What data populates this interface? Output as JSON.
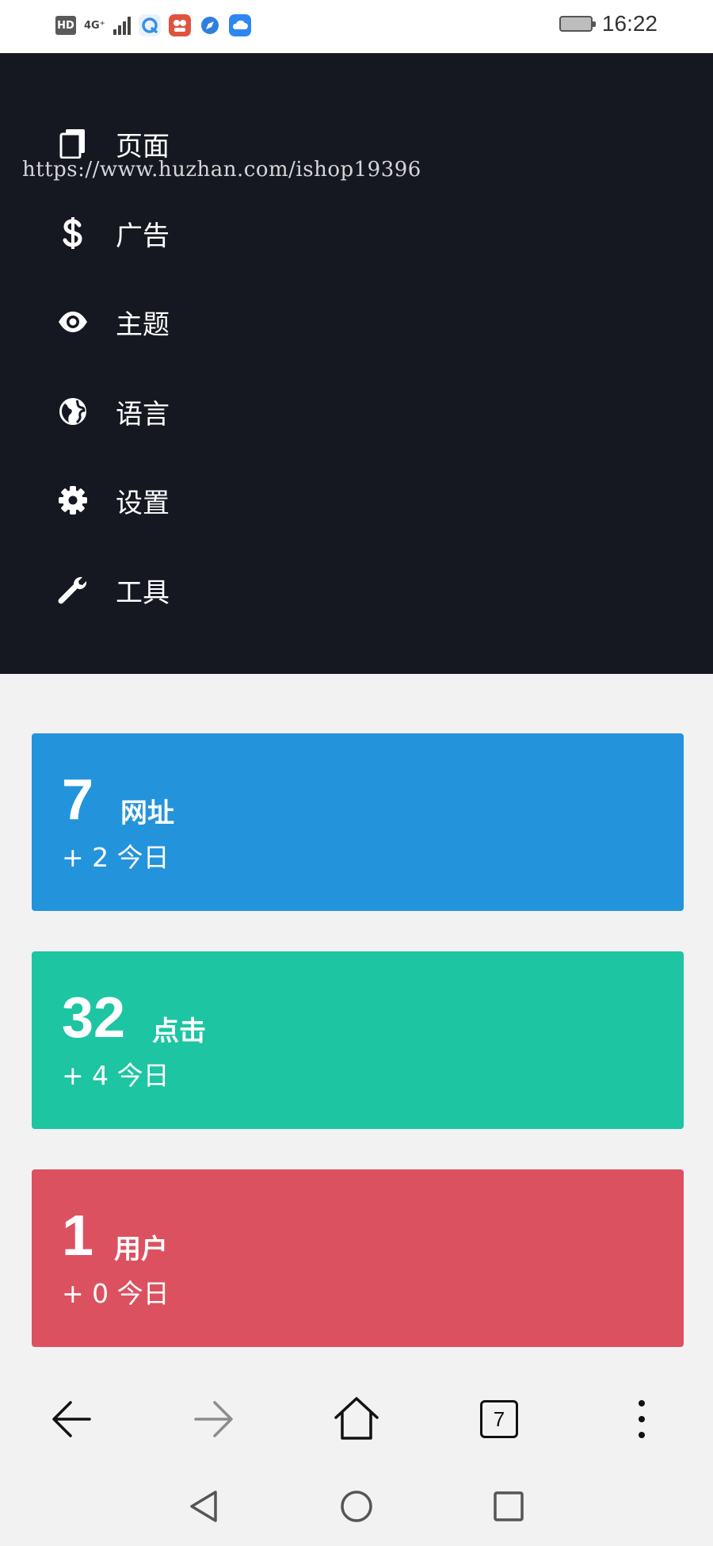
{
  "status_bar": {
    "hd": "HD",
    "network": "4G⁺",
    "time": "16:22",
    "app_icons": [
      {
        "name": "qq-browser-icon",
        "color": "#3a8ee6"
      },
      {
        "name": "photo-app-icon",
        "color": "#e0533d"
      },
      {
        "name": "compass-app-icon",
        "color": "#2f7fe0"
      },
      {
        "name": "cloud-app-icon",
        "color": "#2e86f2"
      }
    ]
  },
  "watermark": "https://www.huzhan.com/ishop19396",
  "menu": {
    "items": [
      {
        "label": "页面",
        "icon": "page-icon"
      },
      {
        "label": "广告",
        "icon": "dollar-icon"
      },
      {
        "label": "主题",
        "icon": "eye-icon"
      },
      {
        "label": "语言",
        "icon": "globe-icon"
      },
      {
        "label": "设置",
        "icon": "gear-icon"
      },
      {
        "label": "工具",
        "icon": "wrench-icon"
      }
    ]
  },
  "stats": [
    {
      "number": "7",
      "label": "网址",
      "today": "+ 2 今日",
      "color": "#2394db"
    },
    {
      "number": "32",
      "label": "点击",
      "today": "+ 4 今日",
      "color": "#1dc5a2"
    },
    {
      "number": "1",
      "label": "用户",
      "today": "+ 0 今日",
      "color": "#dc5160"
    }
  ],
  "browser": {
    "tab_count": "7"
  },
  "colors": {
    "menu_bg": "#161821",
    "page_bg": "#f2f2f3"
  }
}
